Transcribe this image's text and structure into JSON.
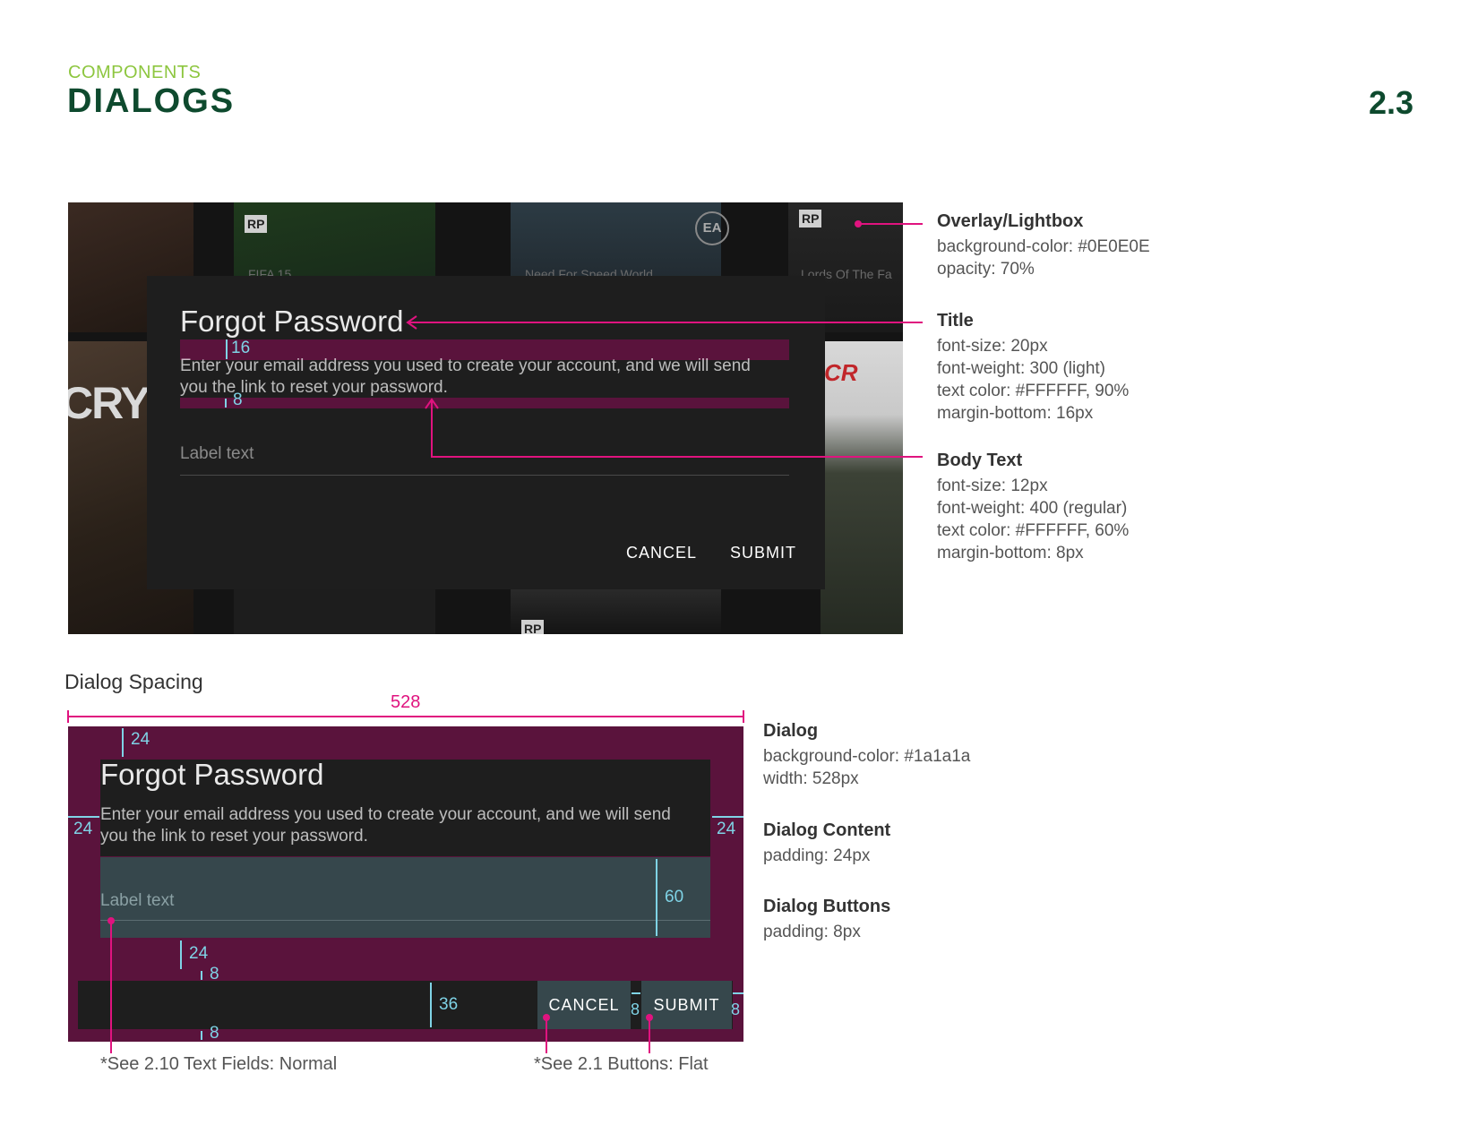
{
  "header": {
    "eyebrow": "COMPONENTS",
    "title": "DIALOGS",
    "page_number": "2.3"
  },
  "mockup": {
    "posters": [
      "FIFA 15",
      "Need For Speed World",
      "Lords Of The Fa"
    ],
    "badges": {
      "rating": "RP",
      "publisher": "EA",
      "game_logo_left": "CRY",
      "game_logo_right": "CR"
    },
    "dialog": {
      "title": "Forgot Password",
      "body_line1": "Enter your email address you used to create your account, and we will send",
      "body_line2": "you the link to reset your password.",
      "field_label": "Label text",
      "cancel": "CANCEL",
      "submit": "SUBMIT"
    },
    "measure": {
      "title_gap": "16",
      "body_gap": "8"
    }
  },
  "notes": [
    {
      "heading": "Overlay/Lightbox",
      "lines": [
        "background-color: #0E0E0E",
        "opacity: 70%"
      ]
    },
    {
      "heading": "Title",
      "lines": [
        "font-size: 20px",
        "font-weight: 300 (light)",
        "text color: #FFFFFF, 90%",
        "margin-bottom: 16px"
      ]
    },
    {
      "heading": "Body Text",
      "lines": [
        "font-size: 12px",
        "font-weight: 400 (regular)",
        "text color: #FFFFFF, 60%",
        "margin-bottom: 8px"
      ]
    }
  ],
  "spacing": {
    "section_title": "Dialog Spacing",
    "width_label": "528",
    "dims": {
      "pad_top": "24",
      "pad_left": "24",
      "pad_right": "24",
      "field_height": "60",
      "field_gap": "24",
      "btn_pad_top": "8",
      "btn_pad_bottom": "8",
      "btn_height": "36",
      "btn_gap": "8",
      "btn_right": "8"
    },
    "footnote_left": "*See 2.10 Text Fields: Normal",
    "footnote_right": "*See 2.1 Buttons: Flat",
    "notes": [
      {
        "heading": "Dialog",
        "lines": [
          "background-color: #1a1a1a",
          "width: 528px"
        ]
      },
      {
        "heading": "Dialog Content",
        "lines": [
          "padding: 24px"
        ]
      },
      {
        "heading": "Dialog Buttons",
        "lines": [
          "padding: 8px"
        ]
      }
    ]
  },
  "colors": {
    "accent": "#e0137f",
    "measure": "#7fd3e6",
    "spacing_bg": "#5a133c",
    "field_bg": "#36474c",
    "dialog_bg": "#1a1a1a",
    "brand_green": "#0e4a2e",
    "light_green": "#8dc63f"
  }
}
